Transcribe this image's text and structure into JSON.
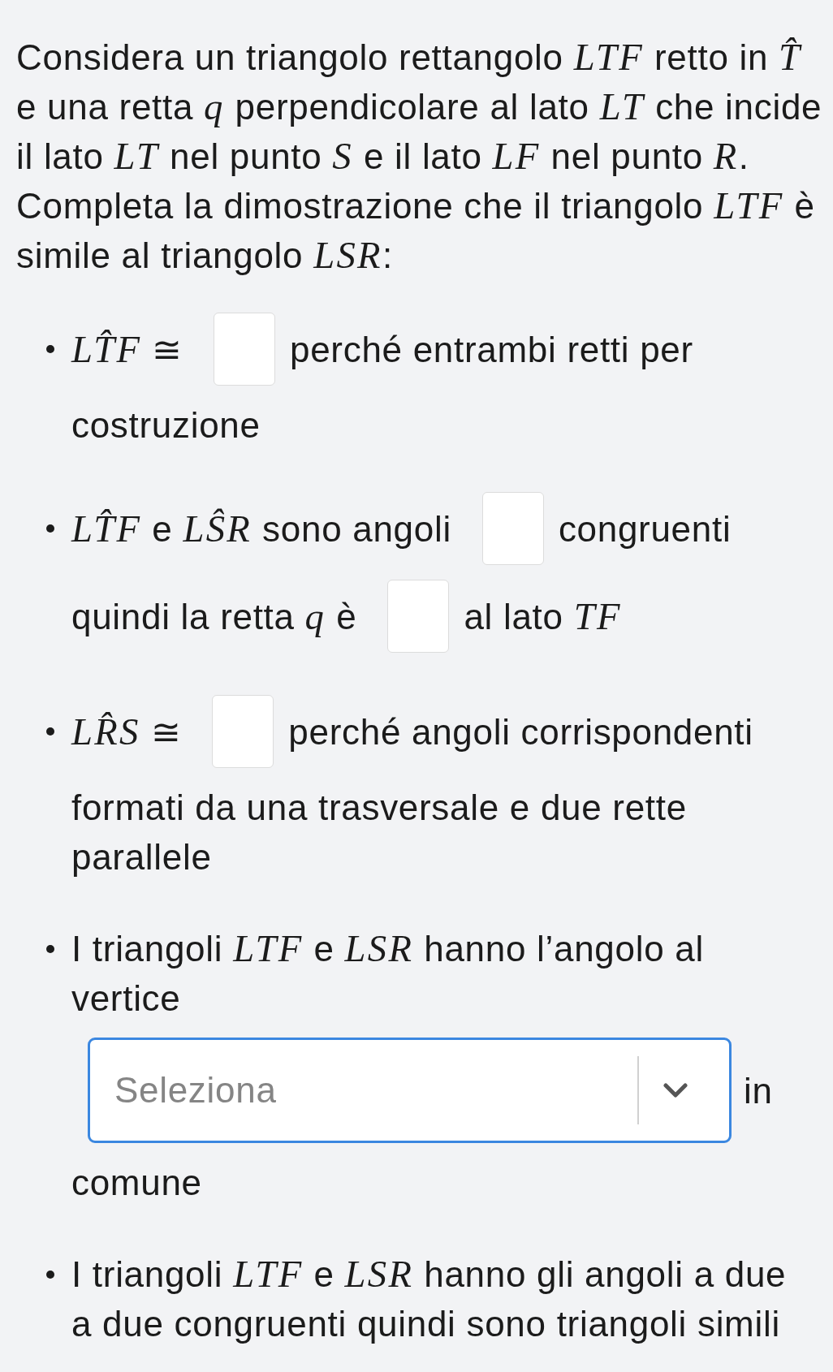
{
  "intro": "Considera un triangolo rettangolo *LTF* retto in *T̂* e una retta *q* perpendicolare al lato *LT* che incide il lato *LT* nel punto *S* e il lato *LF* nel punto *R*. Completa la dimostrazione che il triangolo *LTF* è simile al triangolo *LSR*:",
  "items": [
    {
      "lines": [
        [
          {
            "kind": "text",
            "text": "*LT̂F* ≅"
          },
          {
            "kind": "blank"
          },
          {
            "kind": "text",
            "text": "perché entrambi retti per"
          }
        ],
        [
          {
            "kind": "text",
            "text": "costruzione"
          }
        ]
      ]
    },
    {
      "lines": [
        [
          {
            "kind": "text",
            "text": "*LT̂F* e *LŜR* sono angoli"
          },
          {
            "kind": "blank"
          },
          {
            "kind": "text",
            "text": "congruenti"
          }
        ],
        [
          {
            "kind": "text",
            "text": "quindi la retta *q* è"
          },
          {
            "kind": "blank"
          },
          {
            "kind": "text",
            "text": "al lato *TF*"
          }
        ]
      ]
    },
    {
      "lines": [
        [
          {
            "kind": "text",
            "text": "*LR̂S* ≅"
          },
          {
            "kind": "blank"
          },
          {
            "kind": "text",
            "text": "perché angoli corrispondenti"
          }
        ],
        [
          {
            "kind": "text",
            "text": "formati da una trasversale e due rette parallele"
          }
        ]
      ]
    },
    {
      "lines": [
        [
          {
            "kind": "text",
            "text": "I triangoli *LTF* e *LSR* hanno l’angolo al vertice"
          }
        ],
        [
          {
            "kind": "select",
            "placeholder": "Seleziona",
            "focused": true
          },
          {
            "kind": "text",
            "text": "in"
          }
        ],
        [
          {
            "kind": "text",
            "text": "comune"
          }
        ]
      ]
    },
    {
      "lines": [
        [
          {
            "kind": "text",
            "text": "I triangoli *LTF* e *LSR* hanno gli angoli a due a due congruenti quindi sono triangoli simili"
          }
        ]
      ]
    }
  ]
}
